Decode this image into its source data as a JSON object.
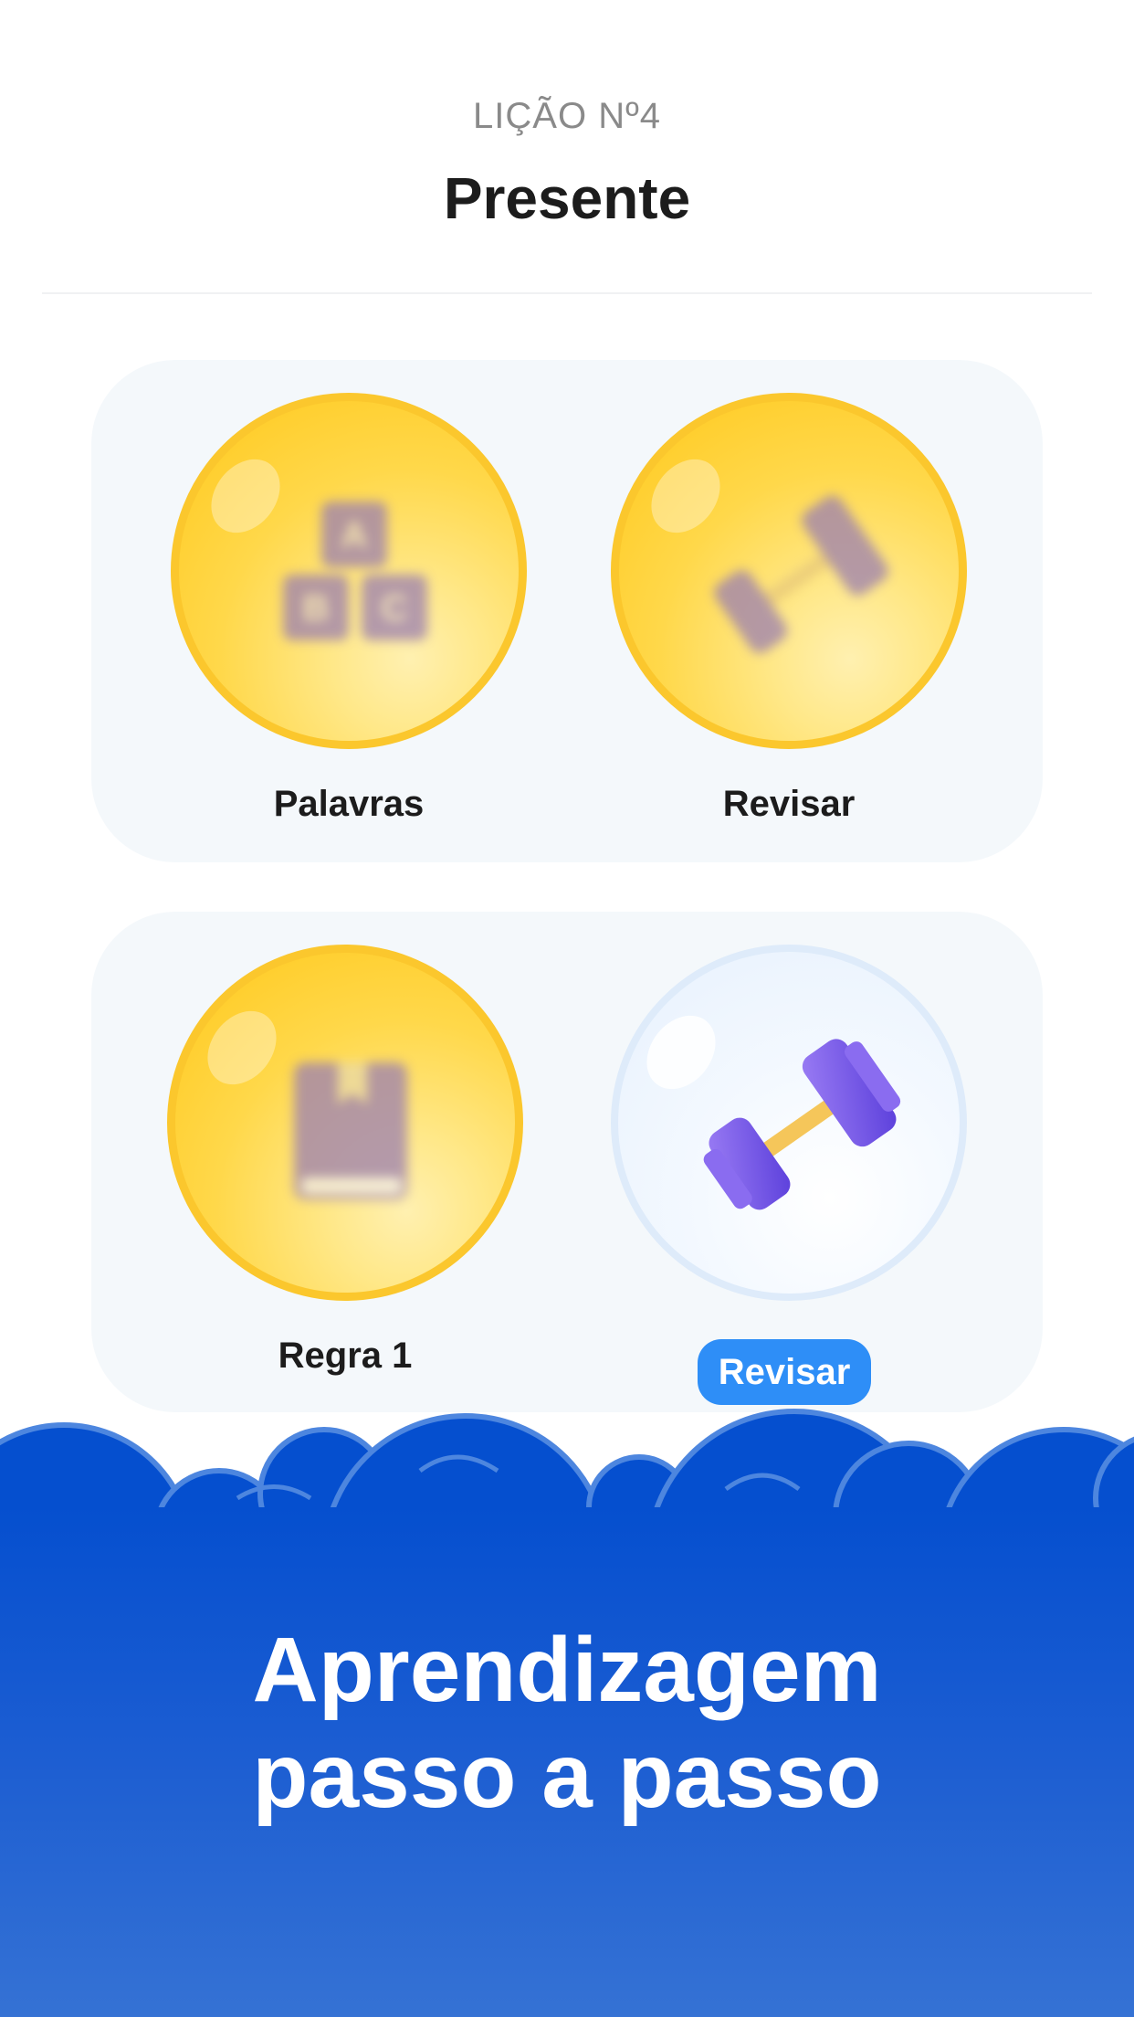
{
  "header": {
    "lesson_number": "LIÇÃO Nº4",
    "title": "Presente"
  },
  "lesson_steps": [
    {
      "label": "Palavras",
      "icon": "abc-blocks-icon",
      "state": "completed"
    },
    {
      "label": "Revisar",
      "icon": "dumbbell-icon",
      "state": "completed"
    },
    {
      "label": "Regra 1",
      "icon": "book-icon",
      "state": "completed"
    },
    {
      "label": "Revisar",
      "icon": "dumbbell-icon",
      "state": "current"
    }
  ],
  "blocks_letters": [
    "A",
    "B",
    "C"
  ],
  "promo": {
    "line1": "Aprendizagem",
    "line2": "passo a passo"
  },
  "colors": {
    "gold": "#ffcd2a",
    "brand_blue": "#054fcf",
    "pill_blue": "#2e8ef7",
    "dumbbell_purple": "#7a5cf0"
  }
}
